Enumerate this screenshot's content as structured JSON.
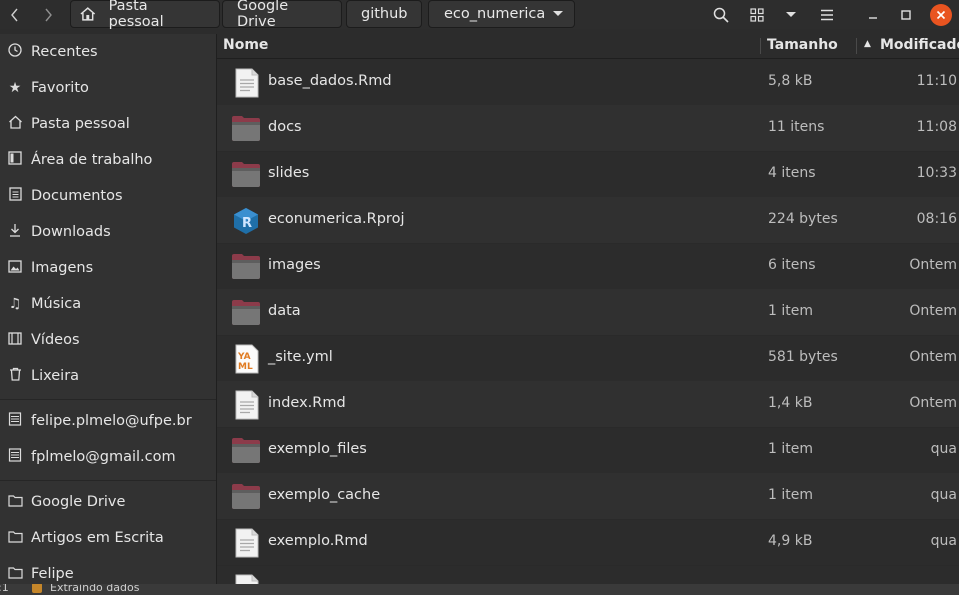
{
  "header": {
    "breadcrumbs": [
      "Pasta pessoal",
      "Google Drive",
      "github",
      "eco_numerica"
    ],
    "icons": [
      "chevron-left-icon",
      "chevron-right-icon",
      "home-icon",
      "search-icon",
      "view-grid-icon",
      "dropdown-icon",
      "menu-icon",
      "minimize-icon",
      "maximize-icon",
      "close-icon"
    ]
  },
  "sidebar": {
    "items": [
      {
        "label": "Recentes",
        "icon": "clock-icon"
      },
      {
        "label": "Favorito",
        "icon": "star-icon"
      },
      {
        "label": "Pasta pessoal",
        "icon": "home-icon"
      },
      {
        "label": "Área de trabalho",
        "icon": "desktop-icon"
      },
      {
        "label": "Documentos",
        "icon": "document-icon"
      },
      {
        "label": "Downloads",
        "icon": "download-icon"
      },
      {
        "label": "Imagens",
        "icon": "image-icon"
      },
      {
        "label": "Música",
        "icon": "music-icon"
      },
      {
        "label": "Vídeos",
        "icon": "video-icon"
      },
      {
        "label": "Lixeira",
        "icon": "trash-icon"
      }
    ],
    "accounts": [
      {
        "label": "felipe.plmelo@ufpe.br",
        "icon": "network-drive-icon"
      },
      {
        "label": "fplmelo@gmail.com",
        "icon": "network-drive-icon"
      }
    ],
    "bookmarks": [
      {
        "label": "Google Drive",
        "icon": "folder-icon"
      },
      {
        "label": "Artigos em Escrita",
        "icon": "folder-icon"
      },
      {
        "label": "Felipe",
        "icon": "folder-icon"
      }
    ]
  },
  "columns": {
    "name": "Nome",
    "size": "Tamanho",
    "modified": "Modificado",
    "sort_indicator": "▲"
  },
  "files": [
    {
      "name": "base_dados.Rmd",
      "size": "5,8 kB",
      "modified": "11:10",
      "type": "text"
    },
    {
      "name": "docs",
      "size": "11 itens",
      "modified": "11:08",
      "type": "folder"
    },
    {
      "name": "slides",
      "size": "4 itens",
      "modified": "10:33",
      "type": "folder"
    },
    {
      "name": "econumerica.Rproj",
      "size": "224 bytes",
      "modified": "08:16",
      "type": "rproj"
    },
    {
      "name": "images",
      "size": "6 itens",
      "modified": "Ontem",
      "type": "folder"
    },
    {
      "name": "data",
      "size": "1 item",
      "modified": "Ontem",
      "type": "folder"
    },
    {
      "name": "_site.yml",
      "size": "581 bytes",
      "modified": "Ontem",
      "type": "yaml"
    },
    {
      "name": "index.Rmd",
      "size": "1,4 kB",
      "modified": "Ontem",
      "type": "text"
    },
    {
      "name": "exemplo_files",
      "size": "1 item",
      "modified": "qua",
      "type": "folder"
    },
    {
      "name": "exemplo_cache",
      "size": "1 item",
      "modified": "qua",
      "type": "folder"
    },
    {
      "name": "exemplo.Rmd",
      "size": "4,9 kB",
      "modified": "qua",
      "type": "text"
    }
  ],
  "statusbar": {
    "position": ":1",
    "message": "Extraindo dados"
  },
  "colors": {
    "accent": "#e95420",
    "folder": "#8c3b4a",
    "background": "#2c2c2c"
  }
}
